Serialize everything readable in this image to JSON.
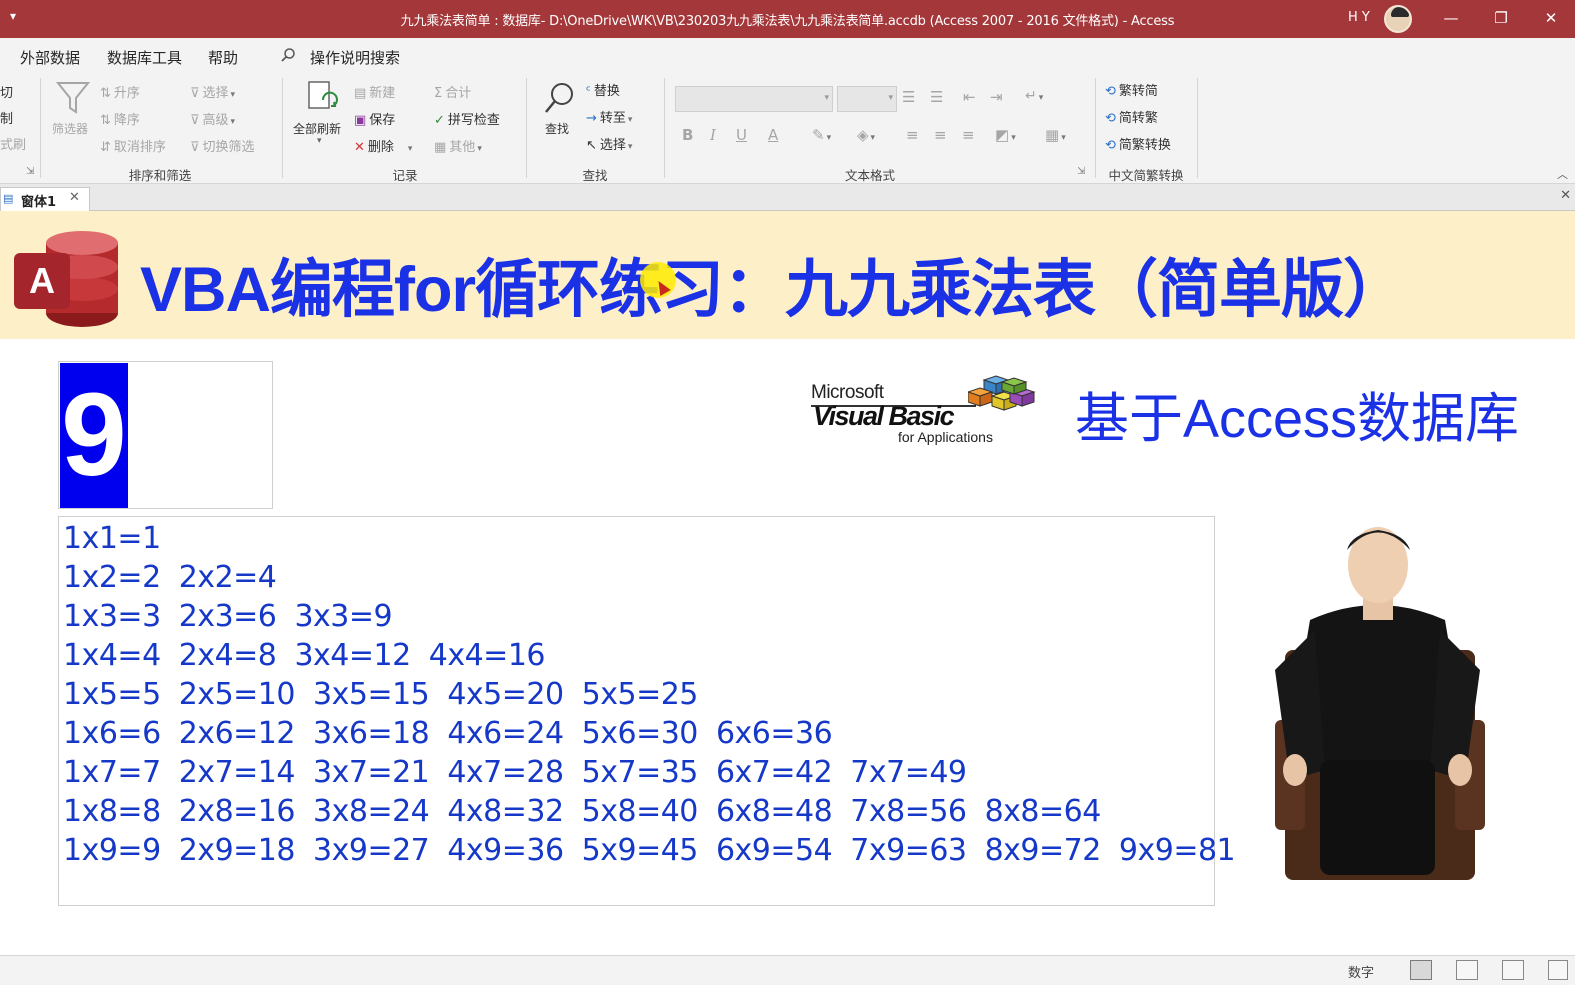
{
  "window": {
    "title": "九九乘法表简单 : 数据库- D:\\OneDrive\\WK\\VB\\230203九九乘法表\\九九乘法表简单.accdb (Access 2007 - 2016 文件格式)  -  Access",
    "user": "H Y",
    "qat_icon": "dropdown-arrow-icon"
  },
  "menu": {
    "items": [
      "外部数据",
      "数据库工具",
      "帮助"
    ],
    "search": "操作说明搜索"
  },
  "ribbon": {
    "clipboard_partial": [
      "切",
      "制",
      "式刷"
    ],
    "sort_filter": {
      "filter_label": "筛选器",
      "ascending": "升序",
      "descending": "降序",
      "remove_sort": "取消排序",
      "selection": "选择",
      "advanced": "高级",
      "toggle_filter": "切换筛选",
      "group_label": "排序和筛选"
    },
    "records": {
      "refresh_all": "全部刷新",
      "new": "新建",
      "save": "保存",
      "delete": "删除",
      "totals": "合计",
      "spelling": "拼写检查",
      "more": "其他",
      "group_label": "记录"
    },
    "find": {
      "find": "查找",
      "replace": "替换",
      "goto": "转至",
      "select": "选择",
      "group_label": "查找"
    },
    "text_format": {
      "bold": "B",
      "italic": "I",
      "underline": "U",
      "font_color": "A",
      "group_label": "文本格式"
    },
    "chinese_convert": {
      "to_simplified": "繁转简",
      "to_traditional": "简转繁",
      "convert": "简繁转换",
      "group_label": "中文简繁转换"
    }
  },
  "document_tab": {
    "label": "窗体1",
    "close": "✕"
  },
  "form": {
    "title": "VBA编程for循环练习：九九乘法表（简单版）",
    "subtitle": "基于Access数据库",
    "number_value": "9",
    "vba_logo": {
      "microsoft": "Microsoft",
      "visual_basic": "Visual Basic",
      "for_applications": "for Applications"
    },
    "table_lines": [
      "1x1=1",
      "1x2=2  2x2=4",
      "1x3=3  2x3=6  3x3=9",
      "1x4=4  2x4=8  3x4=12  4x4=16",
      "1x5=5  2x5=10  3x5=15  4x5=20  5x5=25",
      "1x6=6  2x6=12  3x6=18  4x6=24  5x6=30  6x6=36",
      "1x7=7  2x7=14  3x7=21  4x7=28  5x7=35  6x7=42  7x7=49",
      "1x8=8  2x8=16  3x8=24  4x8=32  5x8=40  6x8=48  7x8=56  8x8=64",
      "1x9=9  2x9=18  3x9=27  4x9=36  5x9=45  6x9=54  7x9=63  8x9=72  9x9=81"
    ]
  },
  "status": {
    "mode": "数字"
  },
  "colors": {
    "title_bar": "#a4373a",
    "header_band": "#fdefc7",
    "title_text": "#1a31e6",
    "table_text": "#1538c8",
    "number_bg": "#0000ee"
  }
}
